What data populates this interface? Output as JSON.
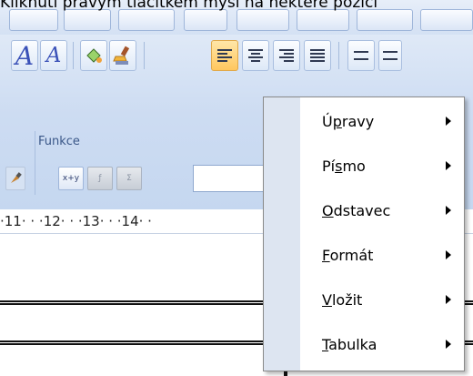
{
  "caption": "Kliknutí pravým tlačítkem myši na některé pozici",
  "ribbon": {
    "group_label": "Funkce",
    "functions": [
      {
        "name": "insert-field-button",
        "label": "x+y",
        "disabled": false
      },
      {
        "name": "function-button-2",
        "label": "ƒ",
        "disabled": true
      },
      {
        "name": "function-button-3",
        "label": "Σ",
        "disabled": true
      }
    ]
  },
  "ruler_text": "·11· · ·12· · ·13· · ·14· ·",
  "context_menu": {
    "items": [
      {
        "label": "Úpravy",
        "accel": "p",
        "has_submenu": true
      },
      {
        "label": "Písmo",
        "accel": "s",
        "has_submenu": true
      },
      {
        "label": "Odstavec",
        "accel": "O",
        "has_submenu": true
      },
      {
        "label": "Formát",
        "accel": "F",
        "has_submenu": true
      },
      {
        "label": "Vložit",
        "accel": "V",
        "has_submenu": true
      },
      {
        "label": "Tabulka",
        "accel": "T",
        "has_submenu": true
      }
    ]
  },
  "colors": {
    "ribbon_top": "#dfe9f7",
    "ribbon_bottom": "#c5d7f0",
    "active_button": "#ffc75e",
    "menu_gutter": "#dde5f1"
  }
}
